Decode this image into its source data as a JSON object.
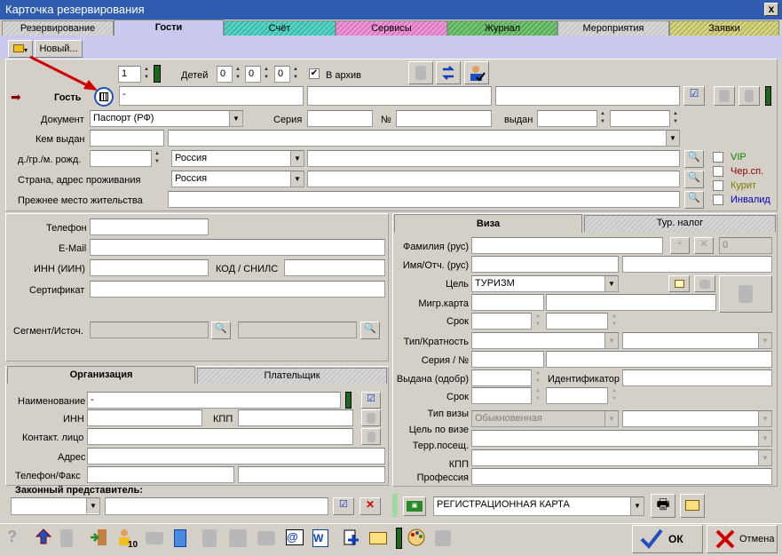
{
  "window": {
    "title": "Карточка резервирования",
    "close": "x"
  },
  "tabs": [
    {
      "label": "Резервирование"
    },
    {
      "label": "Гости"
    },
    {
      "label": "Счёт"
    },
    {
      "label": "Сервисы"
    },
    {
      "label": "Журнал"
    },
    {
      "label": "Мероприятия"
    },
    {
      "label": "Заявки"
    }
  ],
  "guest_tab": {
    "new_label": "Новый..."
  },
  "top": {
    "count": "1",
    "children_label": "Детей",
    "children": [
      "0",
      "0",
      "0"
    ],
    "archive_label": "В архив"
  },
  "guest": {
    "label": "Гость",
    "name": "-",
    "doc_label": "Документ",
    "doc_value": "Паспорт (РФ)",
    "series_label": "Серия",
    "number_label": "№",
    "issued_label": "выдан",
    "issued_by_label": "Кем выдан",
    "birth_label": "д./гр./м. рожд.",
    "birth_country": "Россия",
    "address_label": "Страна, адрес проживания",
    "address_country": "Россия",
    "prev_label": "Прежнее место жительства"
  },
  "flags": {
    "vip": "VIP",
    "blacklist": "Чер.сп.",
    "smoker": "Курит",
    "invalid": "Инвалид"
  },
  "contacts": {
    "phone": "Телефон",
    "email": "E-Mail",
    "inn": "ИНН (ИИН)",
    "snils": "КОД / СНИЛС",
    "cert": "Сертификат",
    "segment": "Сегмент/Источ."
  },
  "org_tabs": {
    "org": "Организация",
    "payer": "Плательщик"
  },
  "org": {
    "name_label": "Наименование",
    "name_value": "-",
    "inn": "ИНН",
    "kpp": "КПП",
    "contact": "Контакт. лицо",
    "address": "Адрес",
    "phonefax": "Телефон/Факс"
  },
  "legal": {
    "label": "Законный представитель:"
  },
  "visa_tabs": {
    "visa": "Виза",
    "tax": "Тур. налог"
  },
  "visa": {
    "surname": "Фамилия (рус)",
    "surname_num": "0",
    "name": "Имя/Отч. (рус)",
    "purpose": "Цель",
    "purpose_value": "ТУРИЗМ",
    "migr": "Мигр.карта",
    "term": "Срок",
    "type": "Тип/Кратность",
    "series": "Серия / №",
    "issued": "Выдана (одобр)",
    "identifier": "Идентификатор",
    "term2": "Срок",
    "visa_type": "Тип визы",
    "visa_type_value": "Обыкновенная",
    "visit": "Цель по визе",
    "terr": "Терр.посещ.",
    "kpp": "КПП",
    "profession": "Профессия"
  },
  "bottom": {
    "reg_card": "РЕГИСТРАЦИОННАЯ КАРТА",
    "ok": "ОК",
    "cancel": "Отмена"
  },
  "colors": {
    "title_bar": "#2f5cae",
    "active_tab": "#c9c9f0",
    "ok_check": "#2050c0",
    "cancel_x": "#d00000",
    "arrow": "#d00000"
  }
}
